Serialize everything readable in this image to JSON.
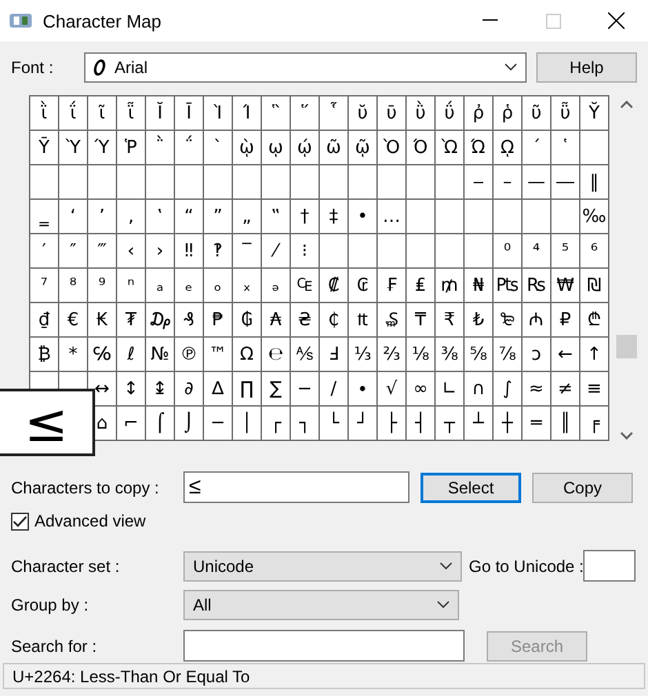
{
  "window": {
    "title": "Character Map"
  },
  "font": {
    "label": "Font :",
    "value": "Arial"
  },
  "help_button": "Help",
  "grid": {
    "rows": [
      [
        "ῒ",
        "ΐ",
        "ῖ",
        "ῗ",
        "Ῐ",
        "Ῑ",
        "Ὶ",
        "Ί",
        "῝",
        "῞",
        "῟",
        "ῠ",
        "ῡ",
        "ῢ",
        "ΰ",
        "ῤ",
        "ῥ",
        "ῦ",
        "ῧ",
        "Ῠ"
      ],
      [
        "Ῡ",
        "Ὺ",
        "Ύ",
        "Ῥ",
        "῭",
        "΅",
        "`",
        "ῲ",
        "ῳ",
        "ῴ",
        "ῶ",
        "ῷ",
        "Ὸ",
        "Ό",
        "Ὼ",
        "Ώ",
        "ῼ",
        "´",
        "῾",
        null
      ],
      [
        null,
        null,
        null,
        null,
        null,
        null,
        null,
        null,
        null,
        null,
        null,
        null,
        null,
        null,
        null,
        "‒",
        "–",
        "—",
        "―",
        "‖"
      ],
      [
        "‗",
        "‘",
        "’",
        "‚",
        "‛",
        "“",
        "”",
        "„",
        "‟",
        "†",
        "‡",
        "•",
        "…",
        null,
        null,
        null,
        null,
        null,
        null,
        "‰"
      ],
      [
        "′",
        "″",
        "‴",
        "‹",
        "›",
        "‼",
        "‽",
        "‾",
        "⁄",
        "⁝",
        null,
        null,
        null,
        null,
        null,
        null,
        "⁰",
        "⁴",
        "⁵",
        "⁶"
      ],
      [
        "⁷",
        "⁸",
        "⁹",
        "ⁿ",
        "ₐ",
        "ₑ",
        "ₒ",
        "ₓ",
        "ₔ",
        "₠",
        "₡",
        "₢",
        "₣",
        "₤",
        "₥",
        "₦",
        "₧",
        "₨",
        "₩",
        "₪"
      ],
      [
        "₫",
        "€",
        "₭",
        "₮",
        "₯",
        "₰",
        "₱",
        "₲",
        "₳",
        "₴",
        "₵",
        "₶",
        "₷",
        "₸",
        "₹",
        "₺",
        "₻",
        "₼",
        "₽",
        "₾"
      ],
      [
        "₿",
        "*",
        "℅",
        "ℓ",
        "№",
        "℗",
        "™",
        "Ω",
        "℮",
        "⅍",
        "Ⅎ",
        "⅓",
        "⅔",
        "⅛",
        "⅜",
        "⅝",
        "⅞",
        "ↄ",
        "←",
        "↑"
      ],
      [
        null,
        null,
        "↔",
        "↕",
        "↨",
        "∂",
        "∆",
        "∏",
        "∑",
        "−",
        "∕",
        "∙",
        "√",
        "∞",
        "∟",
        "∩",
        "∫",
        "≈",
        "≠",
        "≡"
      ],
      [
        null,
        null,
        "⌂",
        "⌐",
        "⌠",
        "⌡",
        "─",
        "│",
        "┌",
        "┐",
        "└",
        "┘",
        "├",
        "┤",
        "┬",
        "┴",
        "┼",
        "═",
        "║",
        "╒"
      ]
    ]
  },
  "enlarged_character": "≤",
  "copy": {
    "label": "Characters to copy :",
    "value": "≤"
  },
  "select_button": {
    "label": "Select",
    "focused": true
  },
  "copy_button": {
    "label": "Copy",
    "focused": false
  },
  "advanced_view": {
    "label": "Advanced view",
    "checked": true
  },
  "character_set": {
    "label": "Character set :",
    "value": "Unicode"
  },
  "go_to_unicode": {
    "label": "Go to Unicode :"
  },
  "group_by": {
    "label": "Group by :",
    "value": "All"
  },
  "search": {
    "label": "Search for :",
    "button": "Search",
    "disabled": true
  },
  "status_bar": "U+2264: Less-Than Or Equal To"
}
